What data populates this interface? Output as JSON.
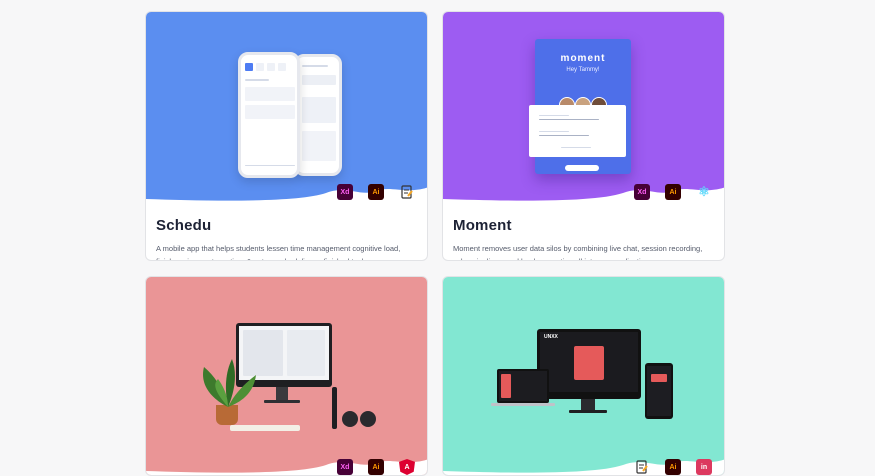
{
  "projects": [
    {
      "title": "Schedu",
      "description": "A mobile app that helps students lessen time management cognitive load, finish assignments on time & auto-rescheduling unfinished tasks.",
      "background": "#5b8ef0",
      "tools": [
        {
          "icon": "adobe-xd-icon",
          "label": "Xd"
        },
        {
          "icon": "adobe-illustrator-icon",
          "label": "Ai"
        },
        {
          "icon": "document-edit-icon",
          "label": ""
        }
      ]
    },
    {
      "title": "Moment",
      "description": "Moment removes user data silos by combining live chat, session recording, sales pipelines, and lead generation all into one application",
      "background": "#9d5cf2",
      "tools": [
        {
          "icon": "adobe-xd-icon",
          "label": "Xd"
        },
        {
          "icon": "adobe-illustrator-icon",
          "label": "Ai"
        },
        {
          "icon": "react-icon",
          "label": "⚛"
        }
      ],
      "mockup": {
        "logo": "moment",
        "greeting": "Hey Tammy!"
      }
    },
    {
      "title": "",
      "description": "",
      "background": "#ea9596",
      "tools": [
        {
          "icon": "adobe-xd-icon",
          "label": "Xd"
        },
        {
          "icon": "adobe-illustrator-icon",
          "label": "Ai"
        },
        {
          "icon": "angular-icon",
          "label": "A"
        }
      ]
    },
    {
      "title": "",
      "description": "",
      "background": "#82e7d2",
      "tools": [
        {
          "icon": "document-edit-icon",
          "label": ""
        },
        {
          "icon": "adobe-illustrator-icon",
          "label": "Ai"
        },
        {
          "icon": "invision-icon",
          "label": "in"
        }
      ],
      "mockup": {
        "screen_title": "UNXX"
      }
    }
  ]
}
